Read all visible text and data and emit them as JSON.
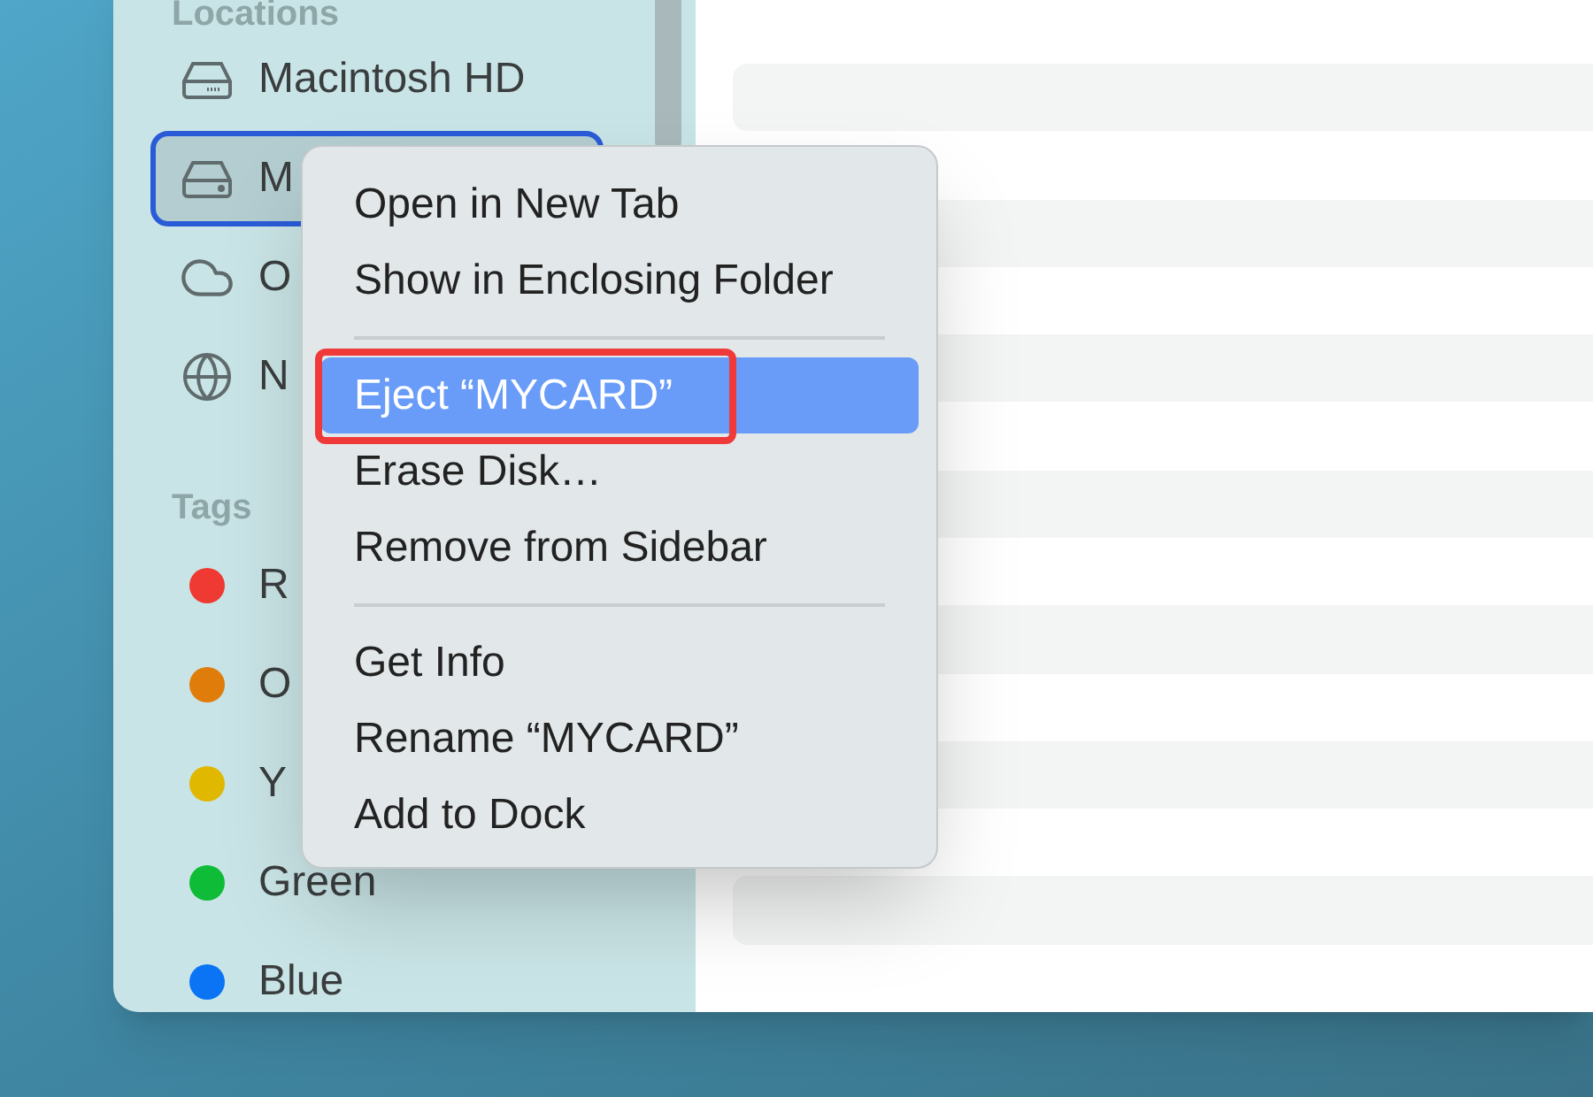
{
  "sidebar": {
    "sections": [
      {
        "title": "Locations",
        "items": [
          {
            "label": "Macintosh HD",
            "selected": false
          },
          {
            "label": "M",
            "selected": true
          },
          {
            "label": "O",
            "selected": false
          },
          {
            "label": "N",
            "selected": false
          }
        ]
      },
      {
        "title": "Tags",
        "items": [
          {
            "label": "R",
            "color": "#ee3a32",
            "selected": false
          },
          {
            "label": "O",
            "color": "#e07c0a",
            "selected": false
          },
          {
            "label": "Y",
            "color": "#e0b800",
            "selected": false
          },
          {
            "label": "Green",
            "color": "#0ebc37",
            "selected": false
          },
          {
            "label": "Blue",
            "color": "#0a74f5",
            "selected": false
          }
        ]
      }
    ]
  },
  "context_menu": {
    "groups": [
      [
        {
          "label": "Open in New Tab",
          "selected": false,
          "annotated": false
        },
        {
          "label": "Show in Enclosing Folder",
          "selected": false,
          "annotated": false
        }
      ],
      [
        {
          "label": "Eject “MYCARD”",
          "selected": true,
          "annotated": true
        },
        {
          "label": "Erase Disk…",
          "selected": false,
          "annotated": false
        },
        {
          "label": "Remove from Sidebar",
          "selected": false,
          "annotated": false
        }
      ],
      [
        {
          "label": "Get Info",
          "selected": false,
          "annotated": false
        },
        {
          "label": "Rename “MYCARD”",
          "selected": false,
          "annotated": false
        },
        {
          "label": "Add to Dock",
          "selected": false,
          "annotated": false
        }
      ]
    ]
  }
}
